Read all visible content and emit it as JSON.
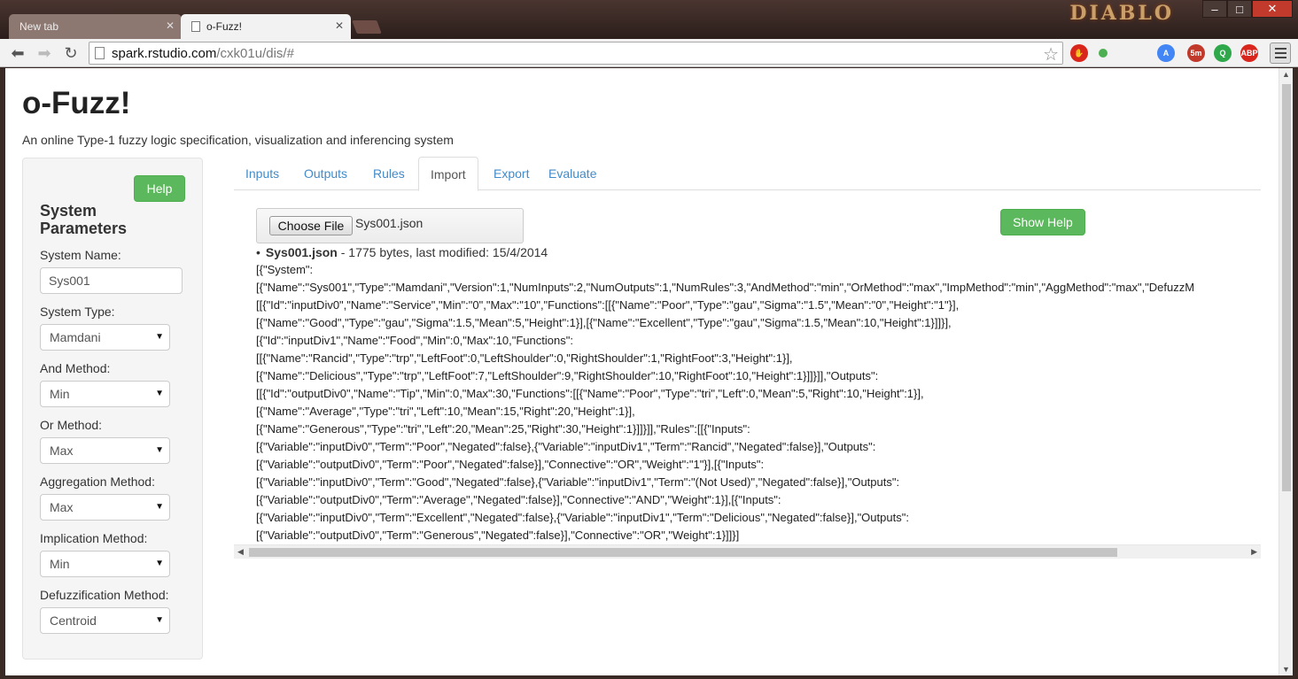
{
  "browser": {
    "tabs": [
      {
        "title": "New tab",
        "active": false
      },
      {
        "title": "o-Fuzz!",
        "active": true
      }
    ],
    "url_host": "spark.rstudio.com",
    "url_path": "/cxk01u/dis/#",
    "game_logo": "DIABLO",
    "extensions": [
      {
        "name": "adblock-stop-icon",
        "color": "#d9261c",
        "label": "✋"
      },
      {
        "name": "status-dot-icon",
        "color": "#4caf50",
        "label": ""
      },
      {
        "name": "translate-icon",
        "color": "#4285f4",
        "label": "A"
      },
      {
        "name": "timer-icon",
        "color": "#c0392b",
        "label": "5m"
      },
      {
        "name": "q-icon",
        "color": "#2ea84a",
        "label": "Q"
      },
      {
        "name": "abp-icon",
        "color": "#d9261c",
        "label": "ABP"
      }
    ]
  },
  "page": {
    "title": "o-Fuzz!",
    "subtitle": "An online Type-1 fuzzy logic specification, visualization and inferencing system"
  },
  "sidebar": {
    "help_label": "Help",
    "heading": "System Parameters",
    "system_name_label": "System Name:",
    "system_name_value": "Sys001",
    "fields": [
      {
        "label": "System Type:",
        "value": "Mamdani"
      },
      {
        "label": "And Method:",
        "value": "Min"
      },
      {
        "label": "Or Method:",
        "value": "Max"
      },
      {
        "label": "Aggregation Method:",
        "value": "Max"
      },
      {
        "label": "Implication Method:",
        "value": "Min"
      },
      {
        "label": "Defuzzification Method:",
        "value": "Centroid"
      }
    ]
  },
  "tabs": [
    "Inputs",
    "Outputs",
    "Rules",
    "Import",
    "Export",
    "Evaluate"
  ],
  "active_tab": "Import",
  "import": {
    "choose_file_label": "Choose File",
    "file_name": "Sys001.json",
    "show_help_label": "Show Help",
    "info_name": "Sys001.json",
    "info_details": " - 1775 bytes, last modified: 15/4/2014",
    "json_lines": [
      "[{\"System\":",
      "[{\"Name\":\"Sys001\",\"Type\":\"Mamdani\",\"Version\":1,\"NumInputs\":2,\"NumOutputs\":1,\"NumRules\":3,\"AndMethod\":\"min\",\"OrMethod\":\"max\",\"ImpMethod\":\"min\",\"AggMethod\":\"max\",\"DefuzzM",
      "[[{\"Id\":\"inputDiv0\",\"Name\":\"Service\",\"Min\":\"0\",\"Max\":\"10\",\"Functions\":[[{\"Name\":\"Poor\",\"Type\":\"gau\",\"Sigma\":\"1.5\",\"Mean\":\"0\",\"Height\":\"1\"}],",
      "[{\"Name\":\"Good\",\"Type\":\"gau\",\"Sigma\":1.5,\"Mean\":5,\"Height\":1}],[{\"Name\":\"Excellent\",\"Type\":\"gau\",\"Sigma\":1.5,\"Mean\":10,\"Height\":1}]]}],",
      "[{\"Id\":\"inputDiv1\",\"Name\":\"Food\",\"Min\":0,\"Max\":10,\"Functions\":",
      "[[{\"Name\":\"Rancid\",\"Type\":\"trp\",\"LeftFoot\":0,\"LeftShoulder\":0,\"RightShoulder\":1,\"RightFoot\":3,\"Height\":1}],",
      "[{\"Name\":\"Delicious\",\"Type\":\"trp\",\"LeftFoot\":7,\"LeftShoulder\":9,\"RightShoulder\":10,\"RightFoot\":10,\"Height\":1}]]}]],\"Outputs\":",
      "[[{\"Id\":\"outputDiv0\",\"Name\":\"Tip\",\"Min\":0,\"Max\":30,\"Functions\":[[{\"Name\":\"Poor\",\"Type\":\"tri\",\"Left\":0,\"Mean\":5,\"Right\":10,\"Height\":1}],",
      "[{\"Name\":\"Average\",\"Type\":\"tri\",\"Left\":10,\"Mean\":15,\"Right\":20,\"Height\":1}],",
      "[{\"Name\":\"Generous\",\"Type\":\"tri\",\"Left\":20,\"Mean\":25,\"Right\":30,\"Height\":1}]]}]],\"Rules\":[[{\"Inputs\":",
      "[{\"Variable\":\"inputDiv0\",\"Term\":\"Poor\",\"Negated\":false},{\"Variable\":\"inputDiv1\",\"Term\":\"Rancid\",\"Negated\":false}],\"Outputs\":",
      "[{\"Variable\":\"outputDiv0\",\"Term\":\"Poor\",\"Negated\":false}],\"Connective\":\"OR\",\"Weight\":\"1\"}],[{\"Inputs\":",
      "[{\"Variable\":\"inputDiv0\",\"Term\":\"Good\",\"Negated\":false},{\"Variable\":\"inputDiv1\",\"Term\":\"(Not Used)\",\"Negated\":false}],\"Outputs\":",
      "[{\"Variable\":\"outputDiv0\",\"Term\":\"Average\",\"Negated\":false}],\"Connective\":\"AND\",\"Weight\":1}],[{\"Inputs\":",
      "[{\"Variable\":\"inputDiv0\",\"Term\":\"Excellent\",\"Negated\":false},{\"Variable\":\"inputDiv1\",\"Term\":\"Delicious\",\"Negated\":false}],\"Outputs\":",
      "[{\"Variable\":\"outputDiv0\",\"Term\":\"Generous\",\"Negated\":false}],\"Connective\":\"OR\",\"Weight\":1}]]}]"
    ]
  }
}
